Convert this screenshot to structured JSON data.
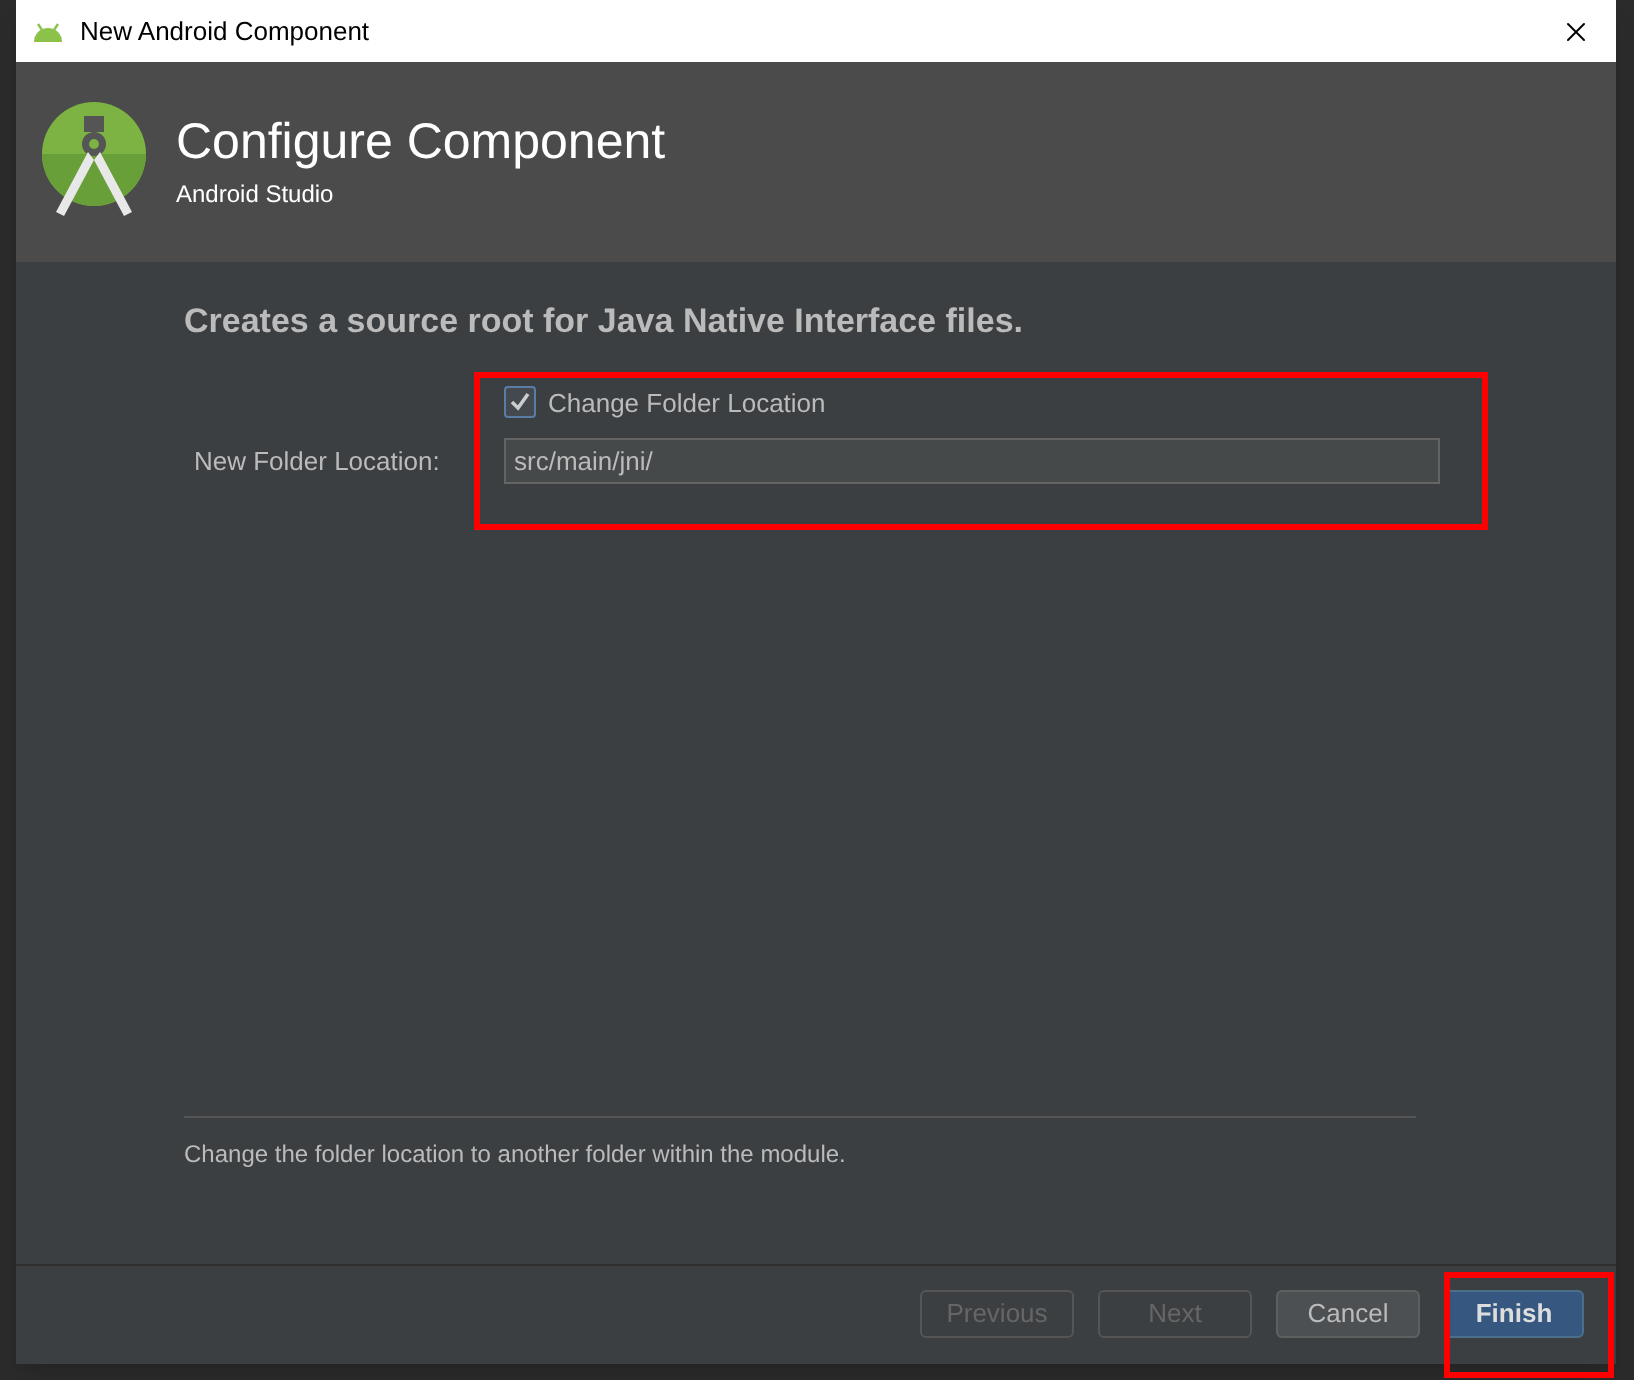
{
  "window": {
    "title": "New Android Component"
  },
  "header": {
    "title": "Configure Component",
    "subtitle": "Android Studio"
  },
  "description": "Creates a source root for Java Native Interface files.",
  "checkbox": {
    "label": "Change Folder Location",
    "checked": true
  },
  "field": {
    "label": "New Folder Location:",
    "value": "src/main/jni/"
  },
  "help_text": "Change the folder location to another folder within the module.",
  "buttons": [
    {
      "label": "Previous",
      "disabled": true,
      "default": false
    },
    {
      "label": "Next",
      "disabled": true,
      "default": false
    },
    {
      "label": "Cancel",
      "disabled": false,
      "default": false
    },
    {
      "label": "Finish",
      "disabled": false,
      "default": true
    }
  ]
}
